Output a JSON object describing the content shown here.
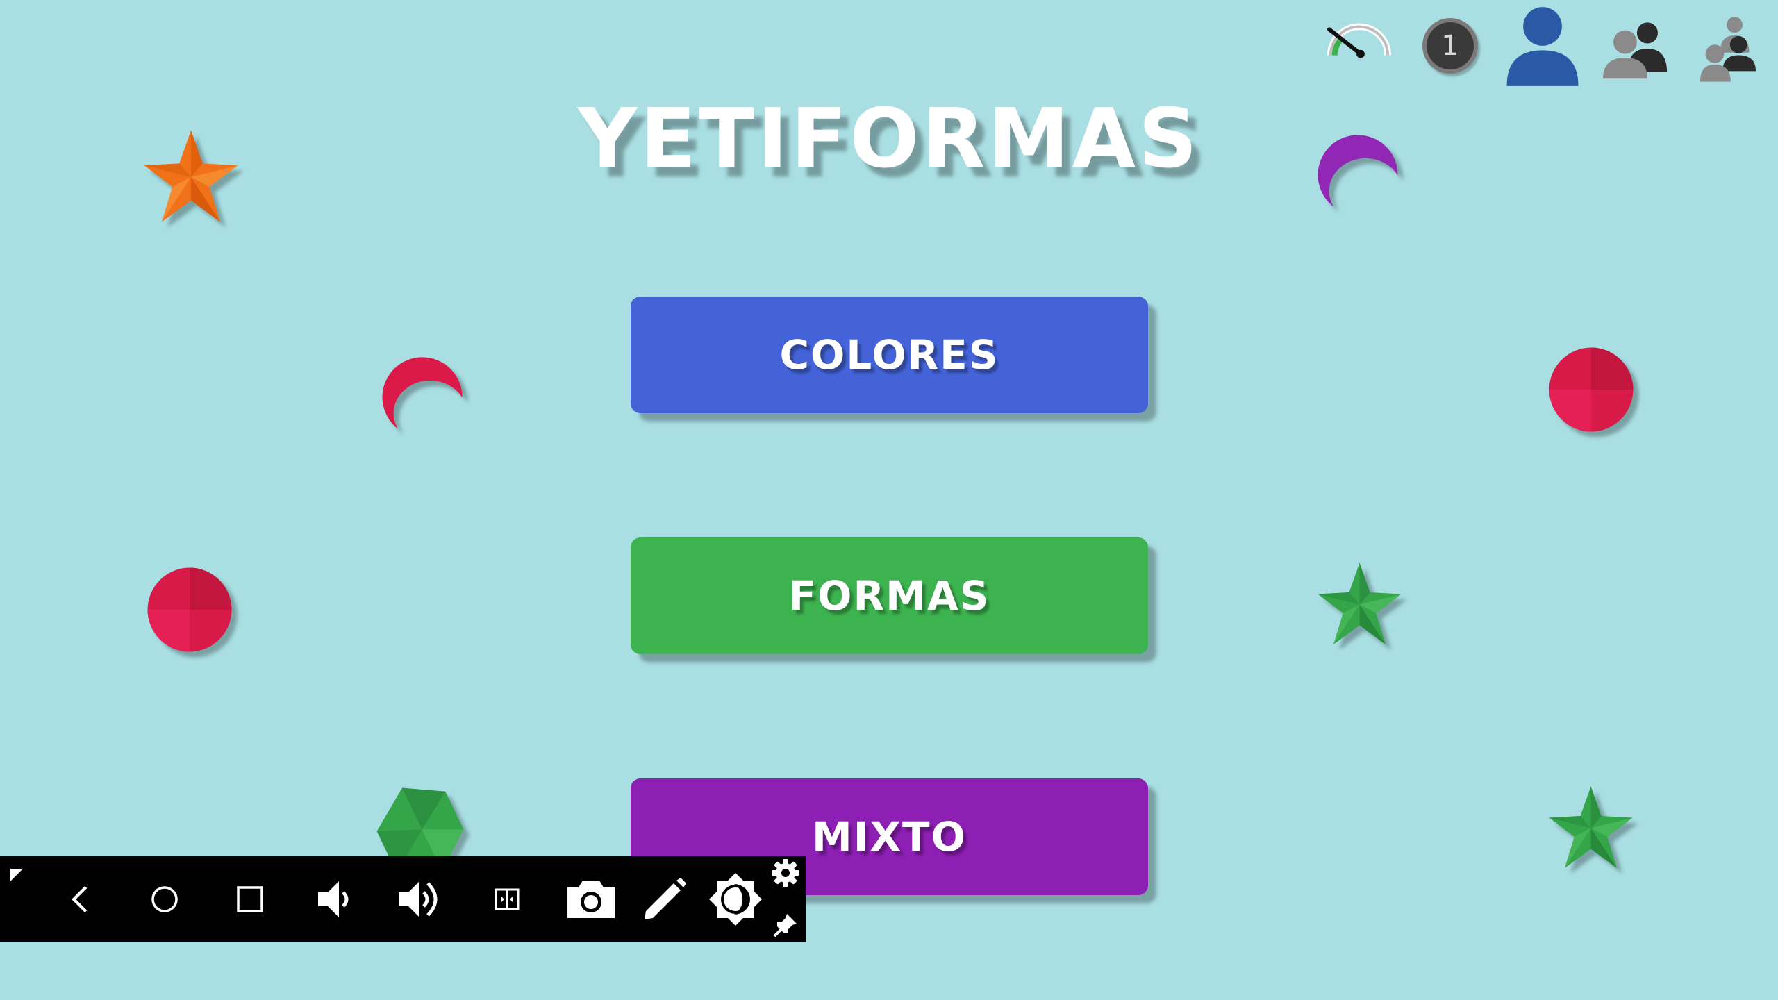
{
  "app": {
    "title": "YETIFORMAS"
  },
  "menu": {
    "buttons": [
      {
        "label": "COLORES",
        "color": "#4463d8"
      },
      {
        "label": "FORMAS",
        "color": "#3cb34e"
      },
      {
        "label": "MIXTO",
        "color": "#8e1fb4"
      }
    ]
  },
  "top_bar": {
    "level_badge": "1",
    "icons": [
      "speed-gauge-icon",
      "single-player-icon",
      "two-players-icon",
      "multi-players-icon"
    ]
  },
  "decorations": [
    {
      "shape": "star",
      "color": "#f07118"
    },
    {
      "shape": "crescent",
      "color": "#9327b5"
    },
    {
      "shape": "crescent",
      "color": "#dc1a4a"
    },
    {
      "shape": "circle",
      "color": "#d81a48"
    },
    {
      "shape": "circle",
      "color": "#d81a48"
    },
    {
      "shape": "star",
      "color": "#34a548"
    },
    {
      "shape": "hexagon",
      "color": "#34a548"
    },
    {
      "shape": "star",
      "color": "#34a548"
    }
  ],
  "nav_bar": {
    "icons": [
      "corner-icon",
      "back-icon",
      "home-icon",
      "recents-icon",
      "volume-down-icon",
      "volume-up-icon",
      "split-screen-icon",
      "camera-icon",
      "pencil-icon",
      "brightness-icon",
      "settings-icon",
      "pin-icon"
    ]
  },
  "colors": {
    "background": "#a9dfe3",
    "title_text": "#ffffff",
    "nav_bar": "#000000"
  }
}
